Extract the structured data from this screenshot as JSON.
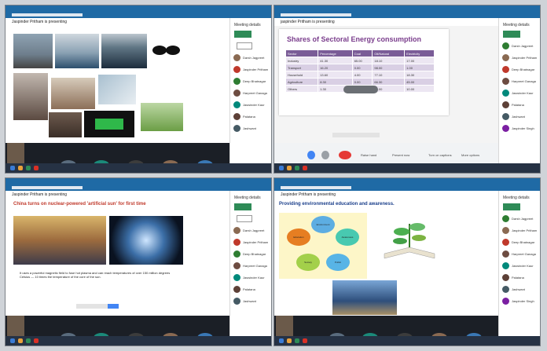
{
  "quadrants": {
    "q1": {
      "presenting": "Jaspinder Pritham is presenting"
    },
    "q2": {
      "presenting": "jaspinder Pritham is presenting",
      "slide_title": "Shares of Sectoral Energy consumption",
      "table": {
        "headers": [
          "Sector",
          "Percentage",
          "Coal",
          "Oil/Natural",
          "Electricity"
        ],
        "rows": [
          [
            "Industry",
            "41.30",
            "65.00",
            "18.10",
            "17.00"
          ],
          [
            "Transport",
            "16.20",
            "0.00",
            "98.00",
            "1.00"
          ],
          [
            "Household",
            "13.60",
            "4.00",
            "77.10",
            "18.30"
          ],
          [
            "Agriculture",
            "8.30",
            "0.00",
            "66.30",
            "45.00"
          ],
          [
            "Others",
            "1.30",
            "",
            "90.00",
            "10.00"
          ]
        ]
      }
    },
    "q3": {
      "presenting": "Jaspinder Pritham is presenting",
      "slide_title": "China turns on nuclear-powered 'artificial sun' for first time",
      "bullet": "It uses a powerful magnetic field to fuse hot plasma and can reach temperatures of over 150 million degrees Celsius — 10 times the temperature of the core of the sun."
    },
    "q4": {
      "presenting": "Jaspinder Pritham is presenting",
      "slide_title": "Providing environmental education and awareness.",
      "circles": [
        "Environment",
        "Education",
        "Awareness",
        "Society",
        "Public"
      ]
    }
  },
  "sidebar": {
    "title": "Meeting details",
    "present_label": "Present"
  },
  "participants": [
    "Darsh Jagpreet",
    "Jaspinder Pritham",
    "Deep Bhatnagar",
    "Harpreet Ganaga",
    "Jaswinder Kaur",
    "Palatana",
    "Jashwant",
    "Jaspinder Singh"
  ],
  "tiles": [
    "Pradeep Sharma",
    "Ambika Kasliwal",
    "Shavinder Singh",
    "Sumit Garg",
    "Tejinder Singh"
  ],
  "controls": {
    "raise_hand": "Raise hand",
    "present_now": "Present now",
    "captions": "Turn on captions",
    "more": "More options"
  },
  "colors": {
    "meet_green": "#2e8b57",
    "titlebar": "#1f6aa5",
    "end_call": "#e53935",
    "slide_purple": "#7a5c97"
  }
}
